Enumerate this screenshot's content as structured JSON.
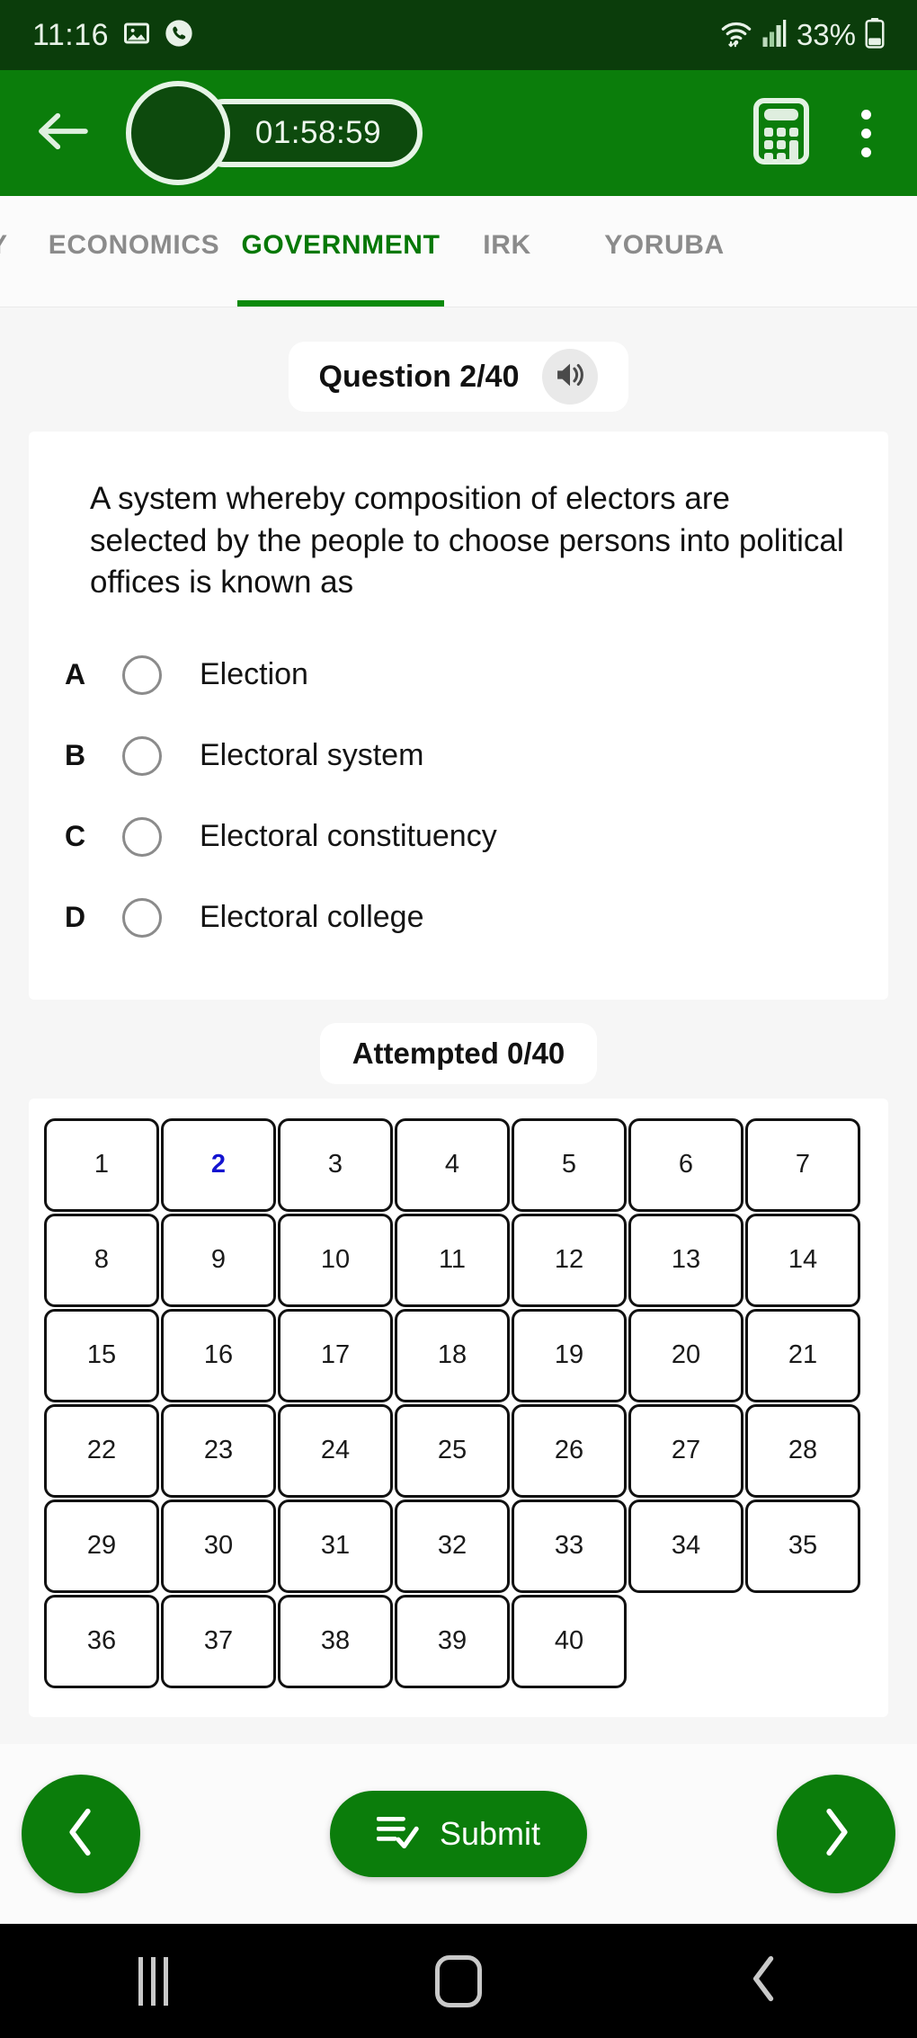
{
  "theme": {
    "brand_green": "#0b7d0b",
    "dark_green": "#0b3d0b",
    "timer_fill": "#0d4a0d",
    "current_number": "#1414d0",
    "page_bg": "#f6f6f6"
  },
  "status_bar": {
    "time": "11:16",
    "battery_percent": "33%",
    "icons": [
      "photo-icon",
      "phone-call-icon",
      "wifi-icon",
      "cellular-signal-icon",
      "battery-icon"
    ]
  },
  "app_bar": {
    "back_icon": "arrow-left-icon",
    "timer": "01:58:59",
    "calculator_icon": "calculator-icon",
    "menu_icon": "kebab-menu-icon"
  },
  "tabs": [
    {
      "label": "Y",
      "active": false
    },
    {
      "label": "ECONOMICS",
      "active": false
    },
    {
      "label": "GOVERNMENT",
      "active": true
    },
    {
      "label": "IRK",
      "active": false
    },
    {
      "label": "YORUBA",
      "active": false
    }
  ],
  "question_header": {
    "title": "Question 2/40",
    "speaker_icon": "speaker-volume-icon"
  },
  "question": {
    "text": "A system whereby composition of electors are selected by the people to choose persons into political offices is known as",
    "options": [
      {
        "letter": "A",
        "text": "Election",
        "selected": false
      },
      {
        "letter": "B",
        "text": "Electoral system",
        "selected": false
      },
      {
        "letter": "C",
        "text": "Electoral constituency",
        "selected": false
      },
      {
        "letter": "D",
        "text": "Electoral college",
        "selected": false
      }
    ]
  },
  "attempted": {
    "label": "Attempted 0/40"
  },
  "number_grid": {
    "total": 40,
    "current": 2,
    "columns": 7,
    "numbers": [
      1,
      2,
      3,
      4,
      5,
      6,
      7,
      8,
      9,
      10,
      11,
      12,
      13,
      14,
      15,
      16,
      17,
      18,
      19,
      20,
      21,
      22,
      23,
      24,
      25,
      26,
      27,
      28,
      29,
      30,
      31,
      32,
      33,
      34,
      35,
      36,
      37,
      38,
      39,
      40
    ]
  },
  "action_bar": {
    "prev_icon": "chevron-left-icon",
    "next_icon": "chevron-right-icon",
    "submit_label": "Submit",
    "submit_icon": "checklist-icon"
  },
  "android_nav": {
    "recents_icon": "recent-apps-icon",
    "home_icon": "home-icon",
    "back_icon": "back-chevron-icon"
  }
}
